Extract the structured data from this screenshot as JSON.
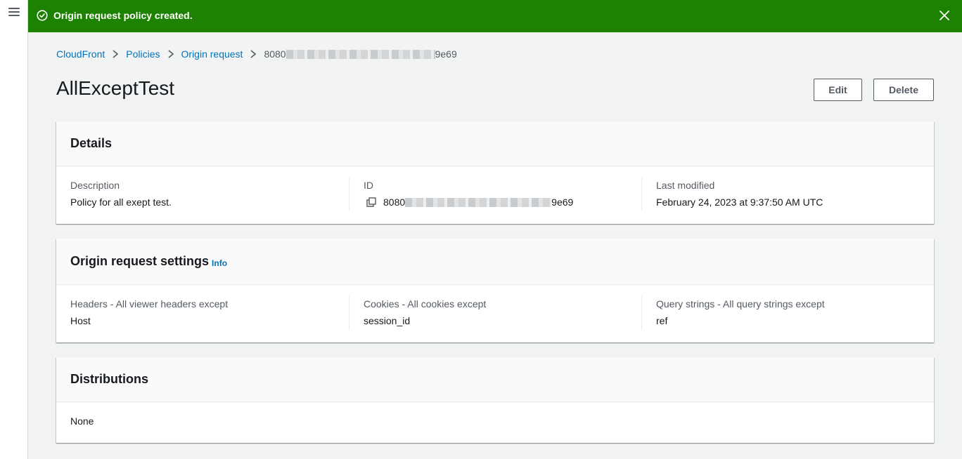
{
  "flash": {
    "message": "Origin request policy created.",
    "color": "#1d8102"
  },
  "nav": {
    "menu_icon": "hamburger-menu-icon"
  },
  "breadcrumb": {
    "items": [
      "CloudFront",
      "Policies",
      "Origin request"
    ],
    "current_prefix": "8080",
    "current_suffix": "9e69"
  },
  "page": {
    "title": "AllExceptTest",
    "edit_label": "Edit",
    "delete_label": "Delete"
  },
  "details": {
    "title": "Details",
    "description_label": "Description",
    "description_value": "Policy for all exept test.",
    "id_label": "ID",
    "id_prefix": "8080",
    "id_suffix": "9e69",
    "modified_label": "Last modified",
    "modified_value": "February 24, 2023 at 9:37:50 AM UTC"
  },
  "settings": {
    "title": "Origin request settings",
    "info_label": "Info",
    "headers_label": "Headers - All viewer headers except",
    "headers_value": "Host",
    "cookies_label": "Cookies - All cookies except",
    "cookies_value": "session_id",
    "query_label": "Query strings - All query strings except",
    "query_value": "ref"
  },
  "distributions": {
    "title": "Distributions",
    "value": "None"
  },
  "colors": {
    "link": "#0073bb",
    "success": "#1d8102"
  }
}
